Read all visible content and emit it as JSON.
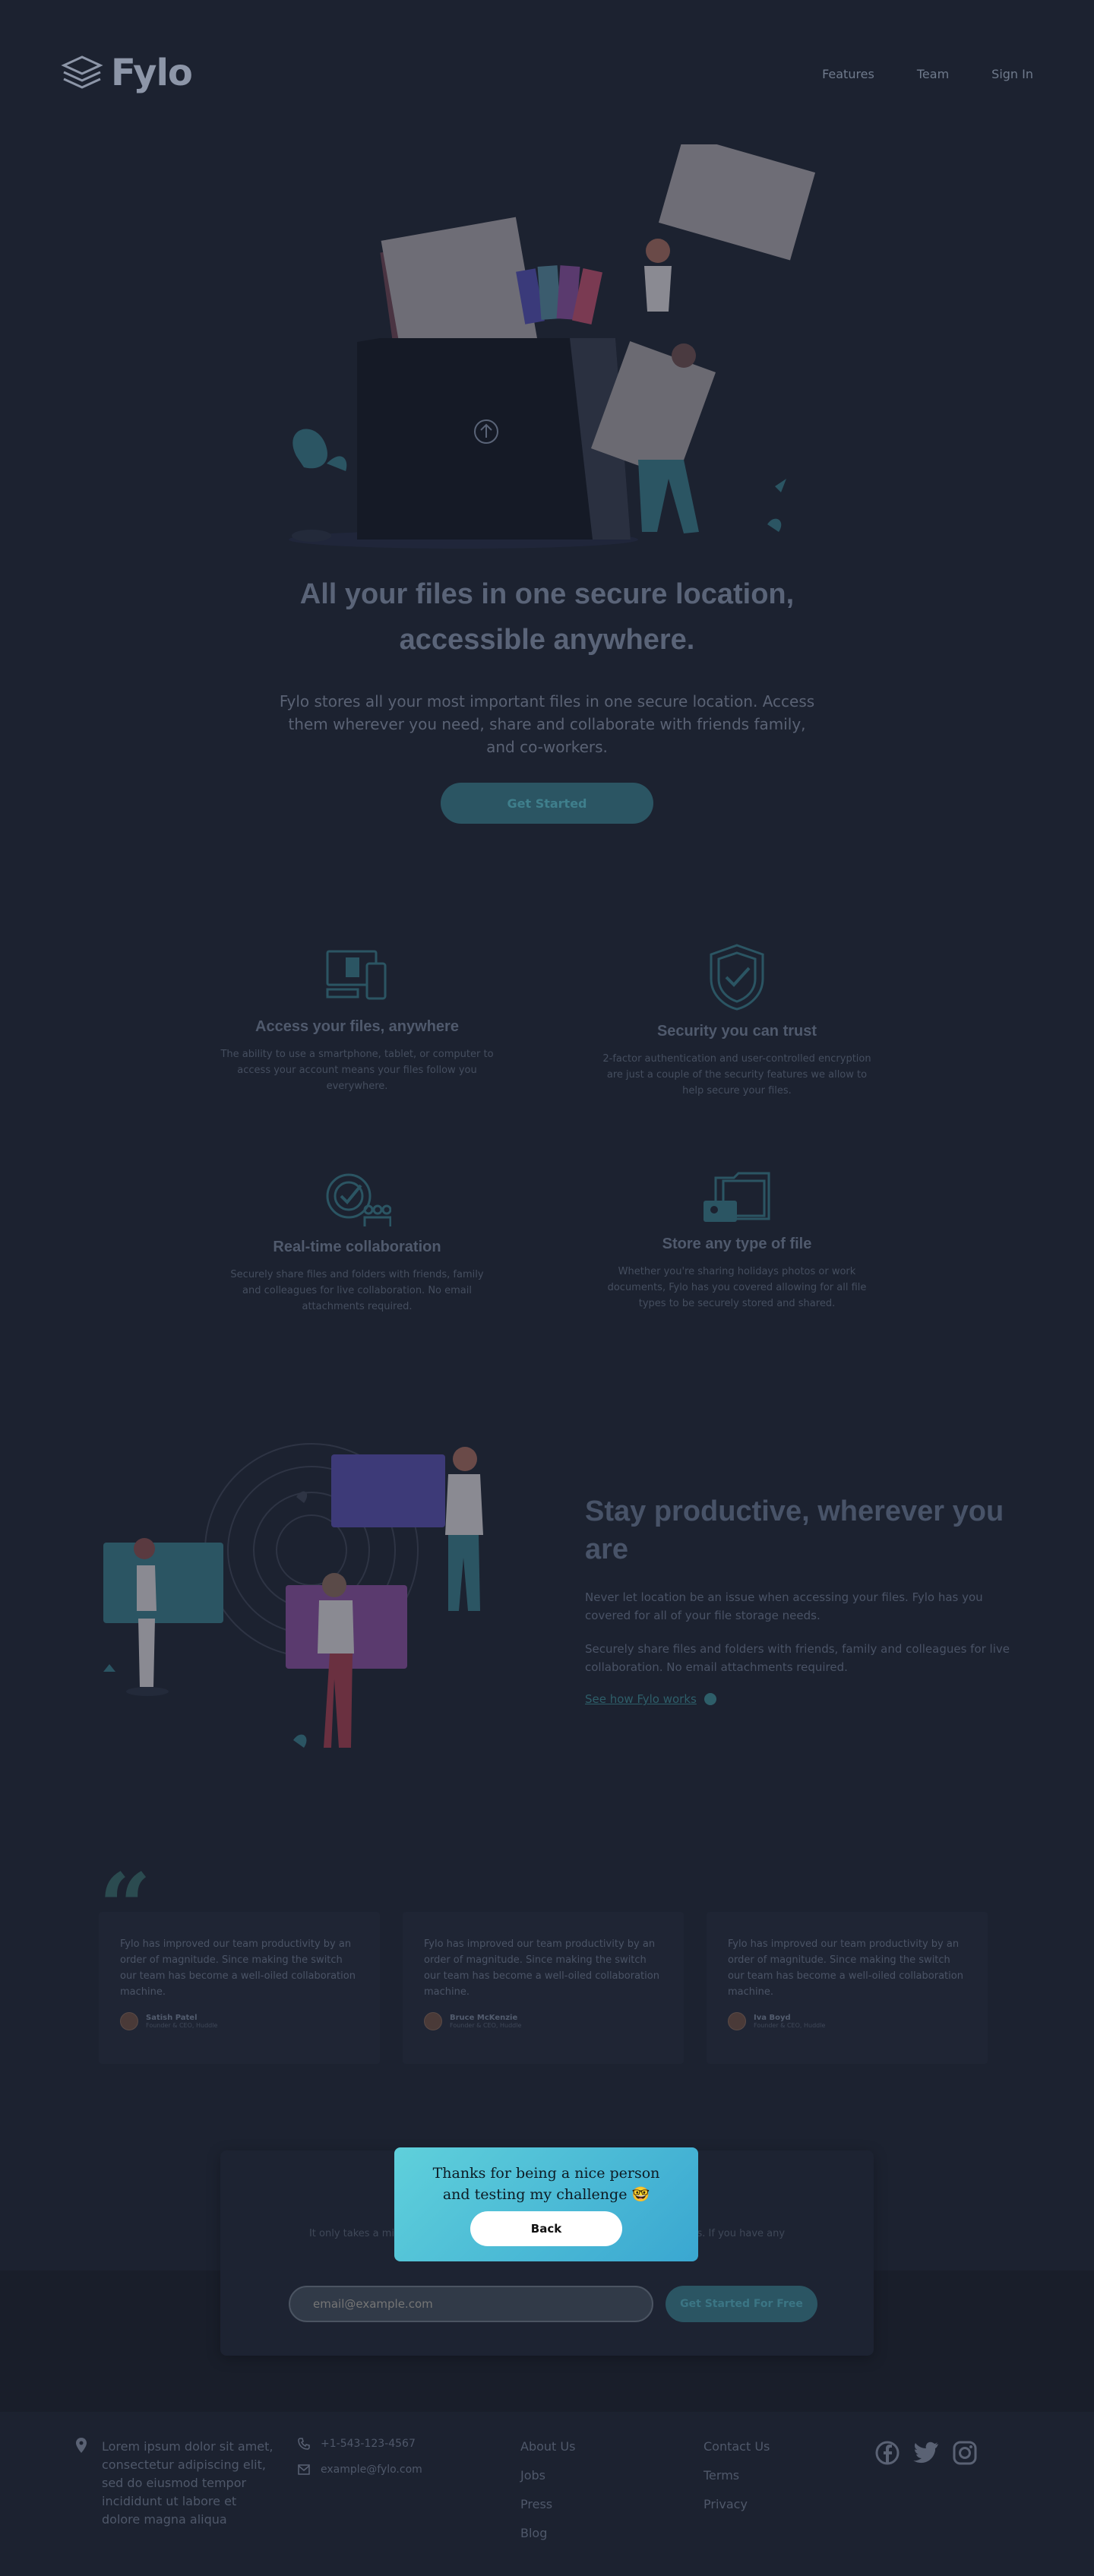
{
  "brand": {
    "name": "Fylo"
  },
  "nav": {
    "features": "Features",
    "team": "Team",
    "signin": "Sign In"
  },
  "hero": {
    "title": "All your files in one secure location, accessible anywhere.",
    "description": "Fylo stores all your most important files in one secure location. Access them wherever you need, share and collaborate with friends family, and co-workers.",
    "cta": "Get Started"
  },
  "features": [
    {
      "title": "Access your files, anywhere",
      "text": "The ability to use a smartphone, tablet, or computer to access your account means your files follow you everywhere.",
      "icon": "devices-icon"
    },
    {
      "title": "Security you can trust",
      "text": "2-factor authentication and user-controlled encryption are just a couple of the security features we allow to help secure your files.",
      "icon": "shield-icon"
    },
    {
      "title": "Real-time collaboration",
      "text": "Securely share files and folders with friends, family and colleagues for live collaboration. No email attachments required.",
      "icon": "collaboration-icon"
    },
    {
      "title": "Store any type of file",
      "text": "Whether you're sharing holidays photos or work documents, Fylo has you covered allowing for all file types to be securely stored and shared.",
      "icon": "folder-icon"
    }
  ],
  "productive": {
    "title": "Stay productive, wherever you are",
    "p1": "Never let location be an issue when accessing your files. Fylo has you covered for all of your file storage needs.",
    "p2": "Securely share files and folders with friends, family and colleagues for live collaboration. No email attachments required.",
    "link": "See how Fylo works"
  },
  "testimonials": [
    {
      "text": "Fylo has improved our team productivity by an order of magnitude. Since making the switch our team has become a well-oiled collaboration machine.",
      "name": "Satish Patel",
      "role": "Founder & CEO, Huddle"
    },
    {
      "text": "Fylo has improved our team productivity by an order of magnitude. Since making the switch our team has become a well-oiled collaboration machine.",
      "name": "Bruce McKenzie",
      "role": "Founder & CEO, Huddle"
    },
    {
      "text": "Fylo has improved our team productivity by an order of magnitude. Since making the switch our team has become a well-oiled collaboration machine.",
      "name": "Iva Boyd",
      "role": "Founder & CEO, Huddle"
    }
  ],
  "cta": {
    "description": "It only takes a minute to sign up and our free starter tier is extremely generous. If you have any",
    "placeholder": "email@example.com",
    "button": "Get Started For Free"
  },
  "modal": {
    "message": "Thanks for being a nice person and testing my challenge 🤓",
    "button": "Back"
  },
  "footer": {
    "address": "Lorem ipsum dolor sit amet, consectetur adipiscing elit, sed do eiusmod tempor incididunt ut labore et dolore magna aliqua",
    "phone": "+1-543-123-4567",
    "email": "example@fylo.com",
    "links1": [
      "About Us",
      "Jobs",
      "Press",
      "Blog"
    ],
    "links2": [
      "Contact Us",
      "Terms",
      "Privacy"
    ]
  }
}
